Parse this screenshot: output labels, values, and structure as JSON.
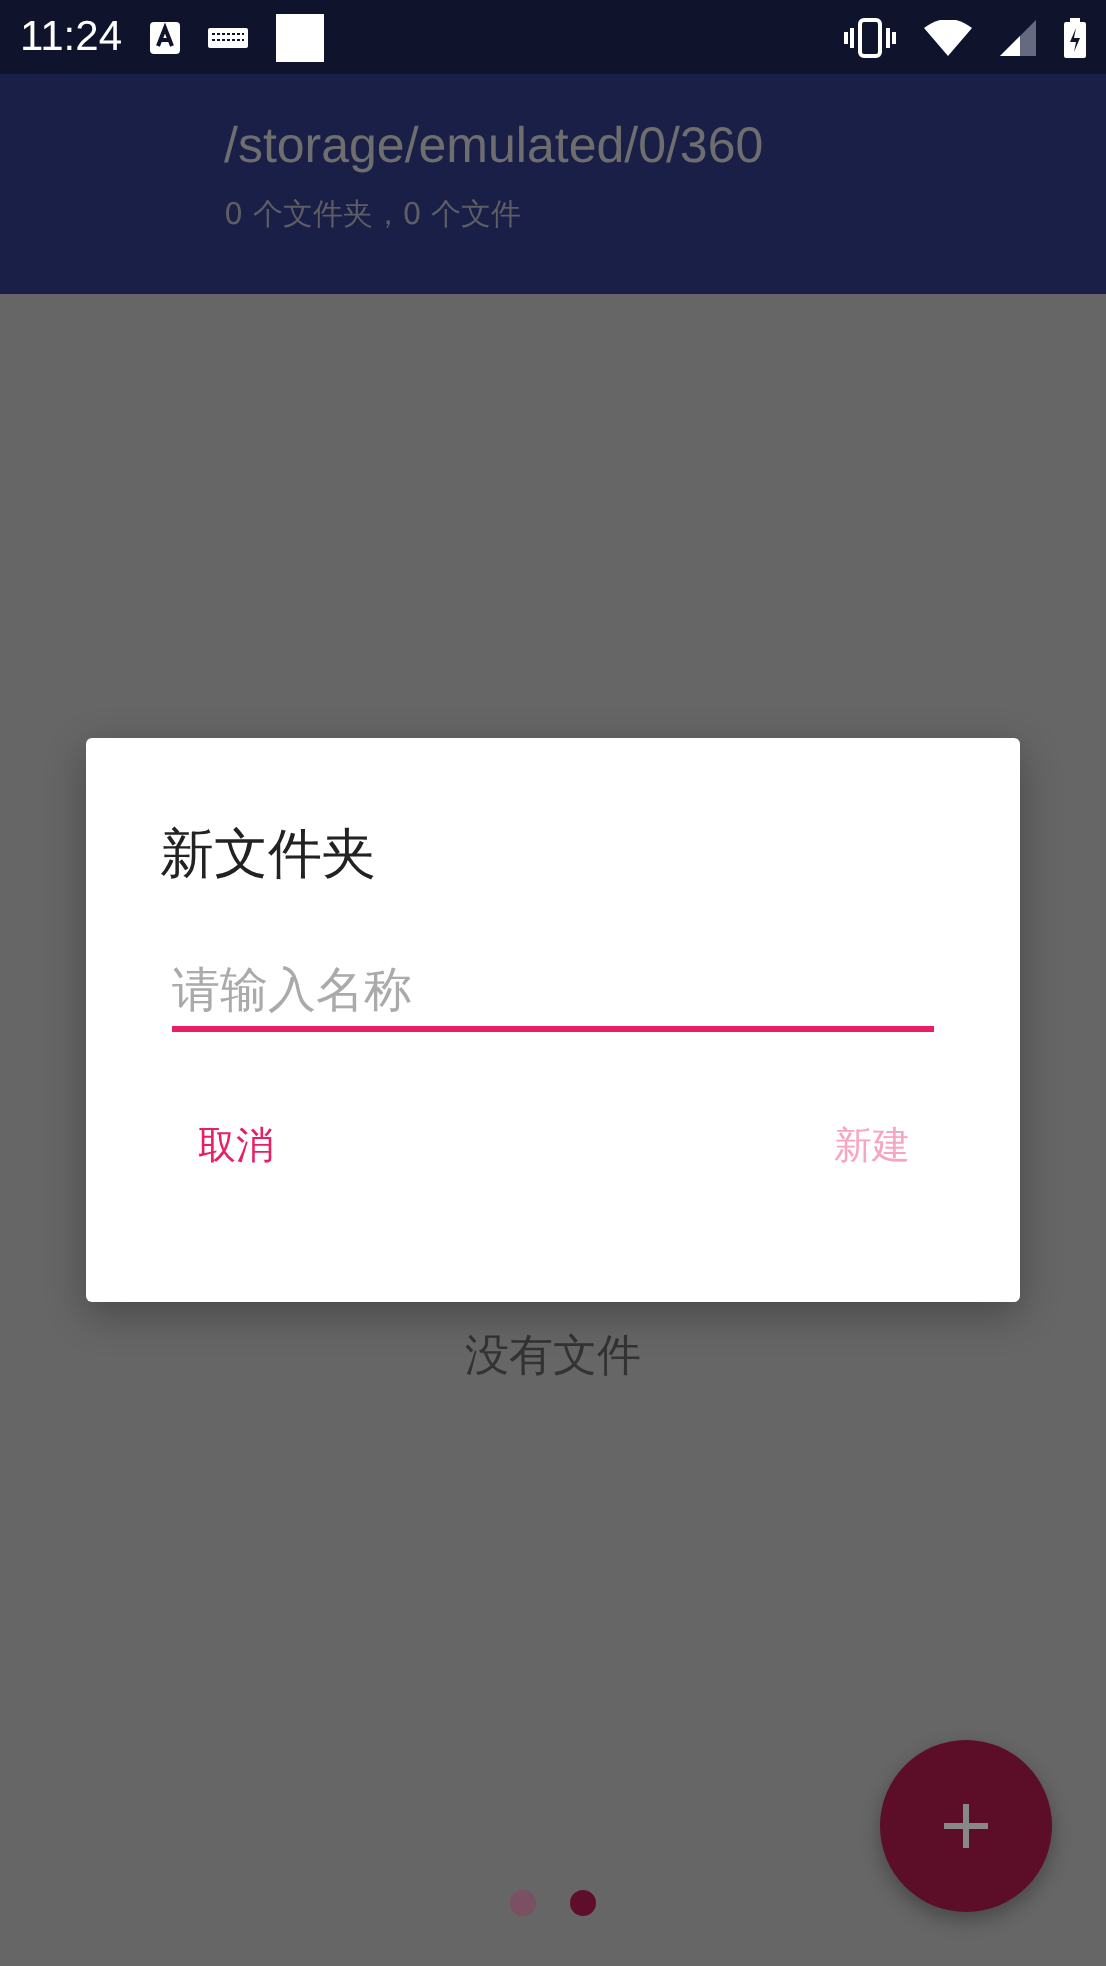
{
  "status_bar": {
    "time": "11:24"
  },
  "header": {
    "path": "/storage/emulated/0/360",
    "summary": "0 个文件夹，0 个文件"
  },
  "empty_message": "没有文件",
  "dialog": {
    "title": "新文件夹",
    "name_field": {
      "placeholder": "请输入名称"
    },
    "buttons": [
      {
        "label": "取消",
        "disabled": false
      },
      {
        "label": "新建",
        "disabled": true
      }
    ]
  },
  "pager": [
    {
      "selected": false
    },
    {
      "selected": true
    }
  ]
}
